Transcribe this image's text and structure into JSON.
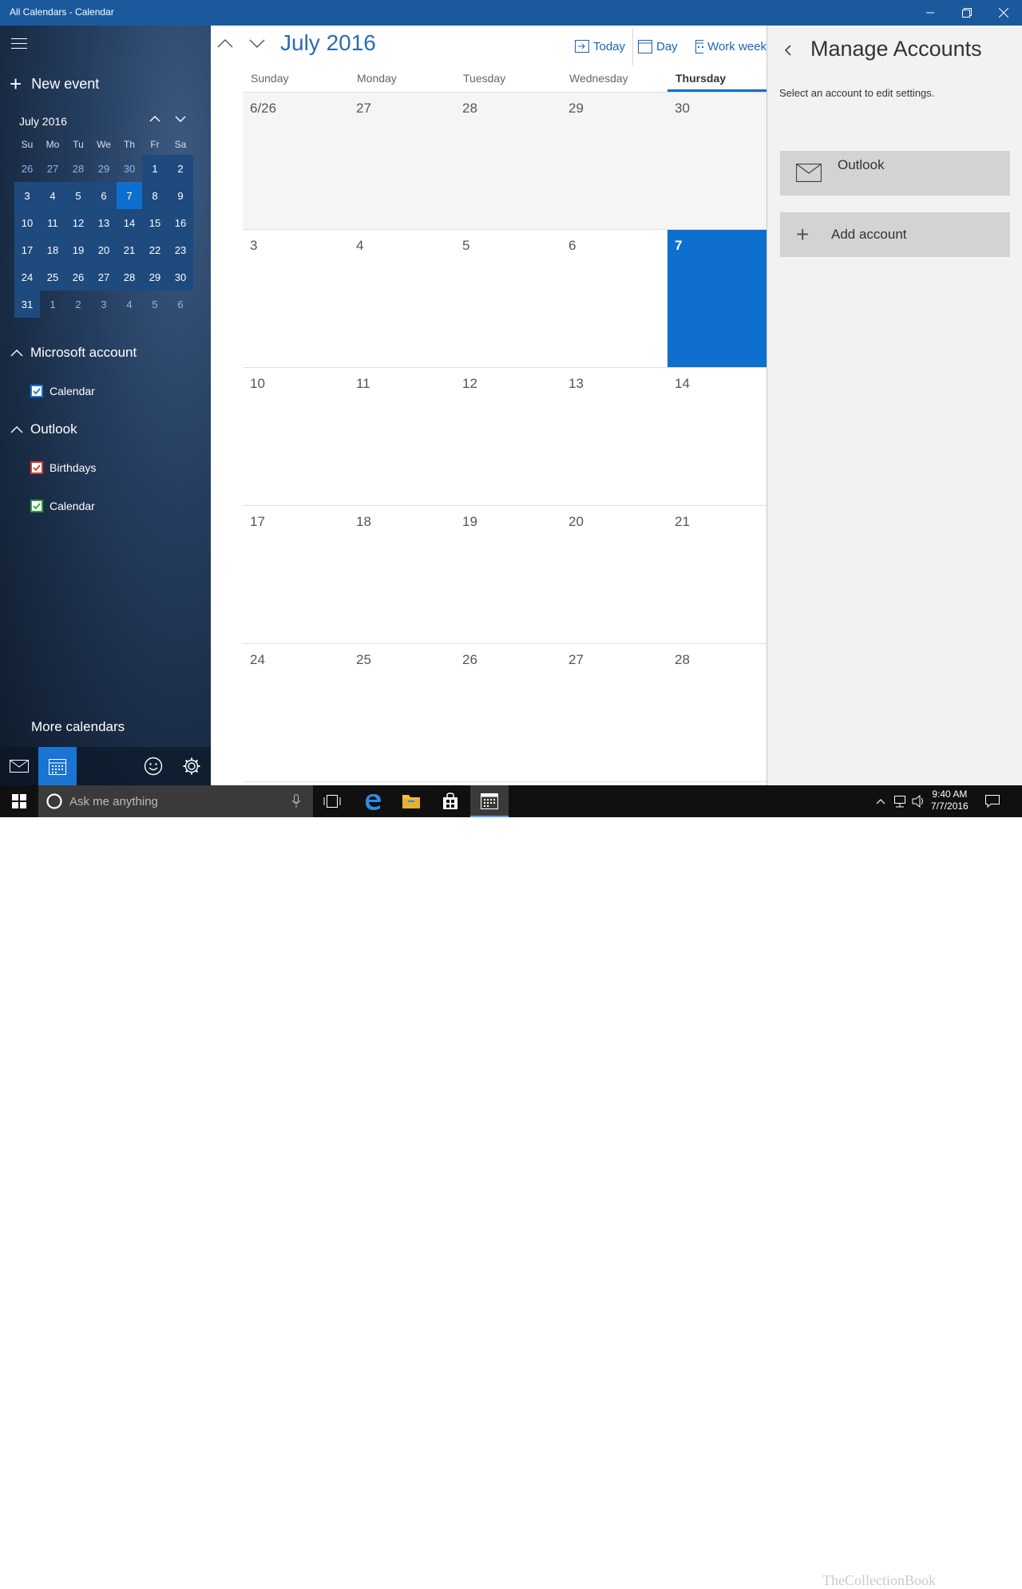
{
  "window": {
    "title": "All Calendars - Calendar"
  },
  "sidebar": {
    "new_event": "New event",
    "mini_calendar": {
      "title": "July 2016",
      "weekdays": [
        "Su",
        "Mo",
        "Tu",
        "We",
        "Th",
        "Fr",
        "Sa"
      ],
      "weeks": [
        [
          "26",
          "27",
          "28",
          "29",
          "30",
          "1",
          "2"
        ],
        [
          "3",
          "4",
          "5",
          "6",
          "7",
          "8",
          "9"
        ],
        [
          "10",
          "11",
          "12",
          "13",
          "14",
          "15",
          "16"
        ],
        [
          "17",
          "18",
          "19",
          "20",
          "21",
          "22",
          "23"
        ],
        [
          "24",
          "25",
          "26",
          "27",
          "28",
          "29",
          "30"
        ],
        [
          "31",
          "1",
          "2",
          "3",
          "4",
          "5",
          "6"
        ]
      ],
      "selected": "7"
    },
    "groups": [
      {
        "label": "Microsoft account",
        "calendars": [
          {
            "label": "Calendar",
            "color": "#1a74d4"
          }
        ]
      },
      {
        "label": "Outlook",
        "calendars": [
          {
            "label": "Birthdays",
            "color": "#d03c28"
          },
          {
            "label": "Calendar",
            "color": "#2e9e3e"
          }
        ]
      }
    ],
    "more_calendars": "More calendars"
  },
  "main": {
    "month_title": "July 2016",
    "toolbar": {
      "today": "Today",
      "day": "Day",
      "work_week": "Work week"
    },
    "day_headers": [
      "Sunday",
      "Monday",
      "Tuesday",
      "Wednesday",
      "Thursday"
    ],
    "active_day_header": "Thursday",
    "weeks": [
      [
        "6/26",
        "27",
        "28",
        "29",
        "30"
      ],
      [
        "3",
        "4",
        "5",
        "6",
        "7"
      ],
      [
        "10",
        "11",
        "12",
        "13",
        "14"
      ],
      [
        "17",
        "18",
        "19",
        "20",
        "21"
      ],
      [
        "24",
        "25",
        "26",
        "27",
        "28"
      ]
    ],
    "today": "7"
  },
  "panel": {
    "title": "Manage Accounts",
    "subtitle": "Select an account to edit settings.",
    "account": "Outlook",
    "add_account": "Add account"
  },
  "taskbar": {
    "search_placeholder": "Ask me anything",
    "time": "9:40 AM",
    "date": "7/7/2016",
    "watermark": "TheCollectionBook"
  },
  "colors": {
    "accent": "#0e6fce",
    "titlebar": "#1a5a9c"
  }
}
